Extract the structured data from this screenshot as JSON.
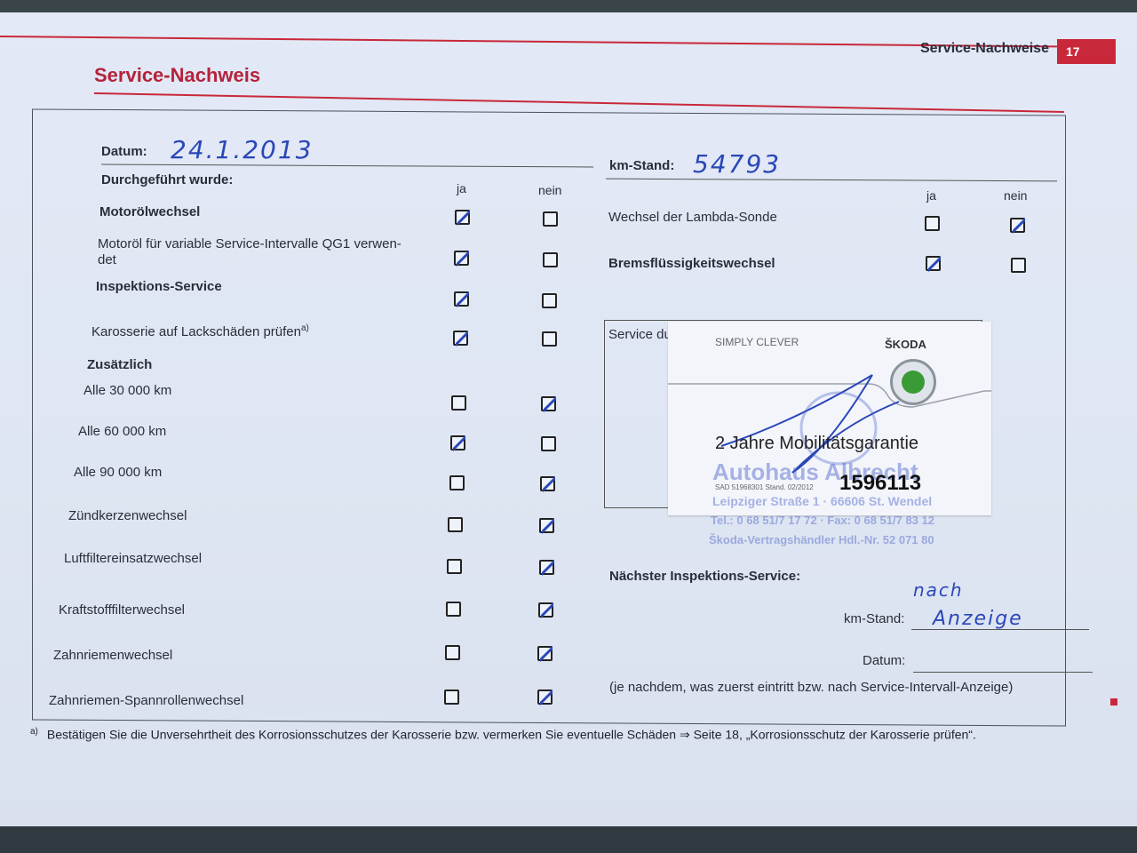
{
  "header": {
    "section": "Service-Nachweise",
    "page": "17"
  },
  "title": "Service-Nachweis",
  "form": {
    "date_label": "Datum:",
    "date_value": "24.1.2013",
    "performed_label": "Durchgeführt wurde:",
    "col_yes": "ja",
    "col_no": "nein",
    "km_label": "km-Stand:",
    "km_value": "54793",
    "items_left": [
      {
        "label": "Motorölwechsel",
        "bold": true,
        "yes": true
      },
      {
        "label": "Motoröl für variable Service-Intervalle QG1 verwen-",
        "label2": "det",
        "bold": false,
        "yes": true
      },
      {
        "label": "Inspektions-Service",
        "bold": true,
        "yes": true
      },
      {
        "label": "Karosserie auf Lackschäden prüfen",
        "sup": "a)",
        "bold": false,
        "yes": true
      },
      {
        "label": "Zusätzlich",
        "bold": true
      },
      {
        "label": "Alle 30 000 km",
        "yes": false
      },
      {
        "label": "Alle 60 000 km",
        "yes": true
      },
      {
        "label": "Alle 90 000 km",
        "yes": false
      },
      {
        "label": "Zündkerzenwechsel",
        "yes": false
      },
      {
        "label": "Luftfiltereinsatzwechsel",
        "yes": false
      },
      {
        "label": "Kraftstofffilterwechsel",
        "yes": false
      },
      {
        "label": "Zahnriemenwechsel",
        "yes": false
      },
      {
        "label": "Zahnriemen-Spannrollenwechsel",
        "yes": false
      }
    ],
    "items_right": [
      {
        "label": "Wechsel der Lambda-Sonde",
        "bold": false,
        "yes": false
      },
      {
        "label": "Bremsflüssigkeitswechsel",
        "bold": true,
        "yes": true
      }
    ],
    "service_label": "Service du",
    "next_label": "Nächster Inspektions-Service:",
    "next_km_label": "km-Stand:",
    "next_km_value_line1": "nach",
    "next_km_value_line2": "Anzeige",
    "next_date_label": "Datum:",
    "note": "(je nachdem, was zuerst eintritt bzw. nach Service-Intervall-Anzeige)"
  },
  "sticker": {
    "slogan": "SIMPLY CLEVER",
    "brand": "ŠKODA",
    "guarantee": "2 Jahre Mobilitätsgarantie",
    "small_code": "SAD 51968301 Stand. 02/2012",
    "number": "1596113"
  },
  "stamp": {
    "name": "Autohaus Albrecht",
    "address": "Leipziger Straße 1 · 66606 St. Wendel",
    "phone": "Tel.: 0 68 51/7 17 72 · Fax: 0 68 51/7 83 12",
    "dealer": "Škoda-Vertragshändler Hdl.-Nr. 52 071 80"
  },
  "footnote": {
    "mark": "a)",
    "text": "Bestätigen Sie die Unversehrtheit des Korrosionsschutzes der Karosserie bzw. vermerken Sie eventuelle Schäden ⇒ Seite 18, „Korrosionsschutz der Karosserie prüfen“."
  },
  "colors": {
    "accent": "#c9283a",
    "ink": "#2a47b8",
    "paper": "#e0e7f4"
  }
}
